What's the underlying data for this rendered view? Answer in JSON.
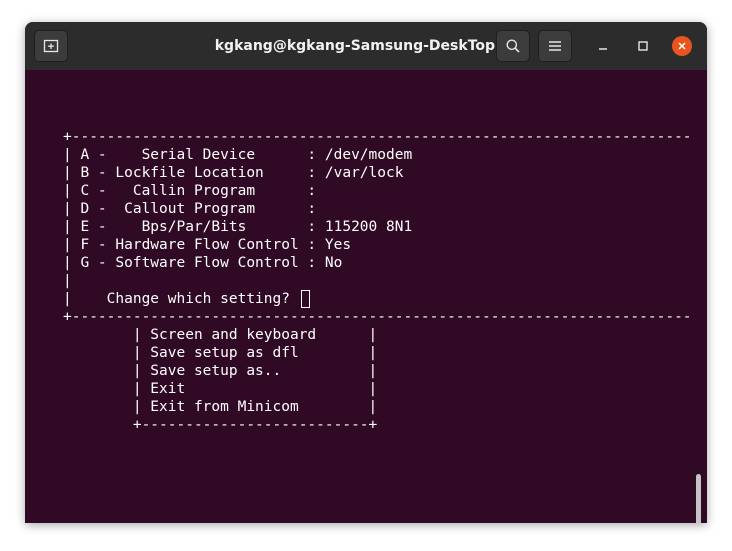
{
  "window": {
    "title": "kgkang@kgkang-Samsung-DeskTop: ~"
  },
  "icons": {
    "new_tab": "new-tab-icon",
    "search": "search-icon",
    "menu": "hamburger-menu-icon",
    "minimize": "minimize-icon",
    "maximize": "maximize-icon",
    "close": "close-icon"
  },
  "colors": {
    "terminal_bg": "#300a24",
    "titlebar_bg": "#2c2c2c",
    "close_button": "#e95420",
    "text": "#ffffff"
  },
  "terminal": {
    "lines": [
      "+-----------------------------------------------------------------------",
      "| A -    Serial Device      : /dev/modem",
      "| B - Lockfile Location     : /var/lock",
      "| C -   Callin Program      :",
      "| D -  Callout Program      :",
      "| E -    Bps/Par/Bits       : 115200 8N1",
      "| F - Hardware Flow Control : Yes",
      "| G - Software Flow Control : No",
      "|",
      "|    Change which setting? ",
      "+-----------------------------------------------------------------------",
      "        | Screen and keyboard      |",
      "        | Save setup as dfl        |",
      "        | Save setup as..          |",
      "        | Exit                     |",
      "        | Exit from Minicom        |",
      "        +--------------------------+"
    ]
  }
}
